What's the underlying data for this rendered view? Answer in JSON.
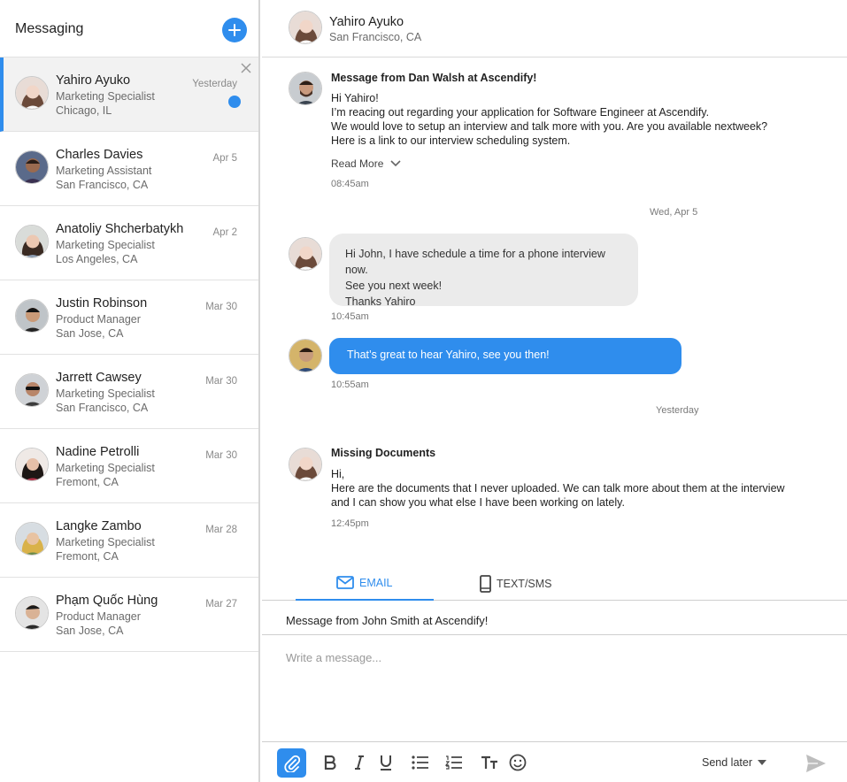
{
  "sidebar": {
    "title": "Messaging",
    "contacts": [
      {
        "name": "Yahiro Ayuko",
        "role": "Marketing Specialist",
        "location": "Chicago, IL",
        "date": "Yesterday",
        "active": true,
        "unread": true
      },
      {
        "name": "Charles Davies",
        "role": "Marketing Assistant",
        "location": "San Francisco, CA",
        "date": "Apr 5"
      },
      {
        "name": "Anatoliy Shcherbatykh",
        "role": "Marketing Specialist",
        "location": "Los Angeles, CA",
        "date": "Apr 2"
      },
      {
        "name": "Justin Robinson",
        "role": "Product Manager",
        "location": "San Jose, CA",
        "date": "Mar 30"
      },
      {
        "name": "Jarrett Cawsey",
        "role": "Marketing Specialist",
        "location": "San Francisco, CA",
        "date": "Mar 30"
      },
      {
        "name": "Nadine Petrolli",
        "role": "Marketing Specialist",
        "location": "Fremont, CA",
        "date": "Mar 30"
      },
      {
        "name": "Langke Zambo",
        "role": "Marketing Specialist",
        "location": "Fremont, CA",
        "date": "Mar 28"
      },
      {
        "name": "Phạm Quốc Hùng",
        "role": "Product Manager",
        "location": "San Jose, CA",
        "date": "Mar 27"
      }
    ]
  },
  "conversation": {
    "header": {
      "name": "Yahiro Ayuko",
      "location": "San Francisco, CA"
    },
    "email1": {
      "subject": "Message from Dan Walsh at Ascendify!",
      "lines": [
        "Hi Yahiro!",
        "I’m reacing out regarding your application for Software Engineer at Ascendify.",
        "We would love to setup an interview and talk more with you. Are you available nextweek?",
        "Here is a link to our interview scheduling system."
      ],
      "read_more": "Read More",
      "time": "08:45am"
    },
    "sep1": "Wed, Apr 5",
    "bubble_in": {
      "lines": [
        "Hi John, I have schedule a time for a phone interview now.",
        "See you next week!",
        "Thanks Yahiro"
      ],
      "time": "10:45am"
    },
    "bubble_out": {
      "text": "That’s great to hear Yahiro, see you then!",
      "time": "10:55am"
    },
    "sep2": "Yesterday",
    "email2": {
      "subject": "Missing Documents",
      "lines": [
        "Hi,",
        "Here are the documents that I never uploaded. We can talk more about them at the interview",
        "and I can show you what else I have been working on lately."
      ],
      "time": "12:45pm"
    }
  },
  "composer": {
    "tabs": {
      "email": "EMAIL",
      "sms": "TEXT/SMS"
    },
    "subject": "Message from John Smith at Ascendify!",
    "placeholder": "Write a message...",
    "send_later": "Send later",
    "accent": "#2f8ded"
  }
}
